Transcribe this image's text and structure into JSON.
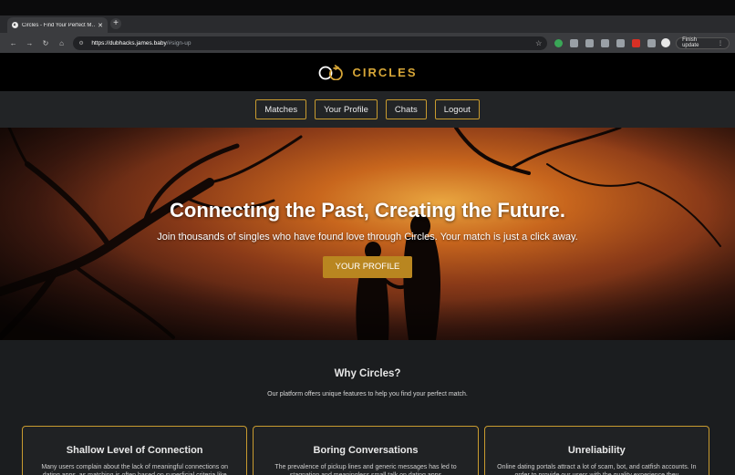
{
  "browser": {
    "tab_title": "Circles - Find Your Perfect M…",
    "url_host": "https://dubhacks.james.baby",
    "url_rest": "/#sign-up",
    "finish_update": "Finish update"
  },
  "site": {
    "brand": "CIRCLES",
    "brand_color": "#d7a637",
    "nav": [
      "Matches",
      "Your Profile",
      "Chats",
      "Logout"
    ]
  },
  "hero": {
    "title": "Connecting the Past, Creating the Future.",
    "subtitle": "Join thousands of singles who have found love through Circles. Your match is just a click away.",
    "cta": "YOUR PROFILE"
  },
  "why": {
    "title": "Why Circles?",
    "subtitle": "Our platform offers unique features to help you find your perfect match.",
    "cards": [
      {
        "title": "Shallow Level of Connection",
        "text": "Many users complain about the lack of meaningful connections on dating apps, as matching is often based on superficial criteria like"
      },
      {
        "title": "Boring Conversations",
        "text": "The prevalence of pickup lines and generic messages has led to stagnation and meaningless small talk on dating apps"
      },
      {
        "title": "Unreliability",
        "text": "Online dating portals attract a lot of scam, bot, and catfish accounts. In order to provide our users with the quality experience they"
      }
    ]
  }
}
